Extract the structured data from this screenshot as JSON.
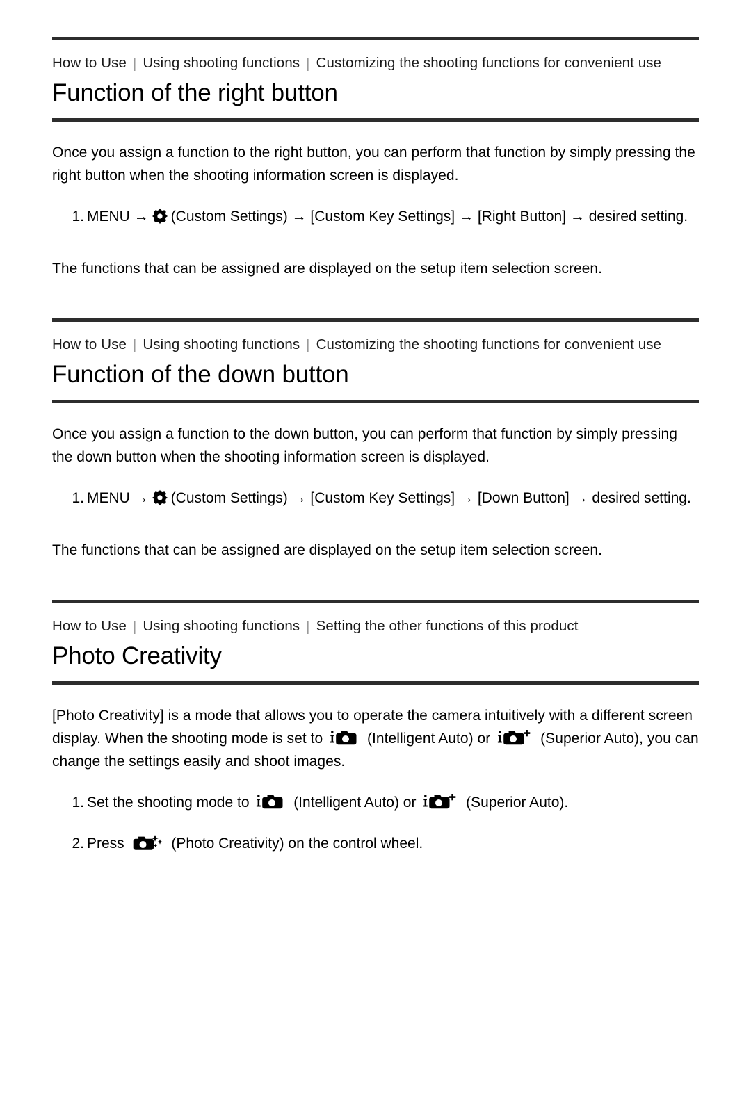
{
  "document": {
    "title": "Function of the right button / Function of the down button / Photo Creativity",
    "sections": [
      {
        "id": "function-right-button",
        "breadcrumb": [
          "How to Use",
          "Using shooting functions",
          "Customizing the shooting functions for convenient use"
        ],
        "heading": "Function of the right button",
        "intro": "Once you assign a function to the right button, you can perform that function by simply pressing the right button when the shooting information screen is displayed.",
        "step_number": "1.",
        "step_part1": "MENU →",
        "step_icon": "gear-icon",
        "step_part2": "(Custom Settings) → [Custom Key Settings] → [Right Button] → desired setting.",
        "note": "The functions that can be assigned are displayed on the setup item selection screen."
      },
      {
        "id": "function-down-button",
        "breadcrumb": [
          "How to Use",
          "Using shooting functions",
          "Customizing the shooting functions for convenient use"
        ],
        "heading": "Function of the down button",
        "intro": "Once you assign a function to the down button, you can perform that function by simply pressing the down button when the shooting information screen is displayed.",
        "step_number": "1.",
        "step_part1": "MENU →",
        "step_icon": "gear-icon",
        "step_part2": "(Custom Settings) → [Custom Key Settings] → [Down Button] → desired setting.",
        "note": "The functions that can be assigned are displayed on the setup item selection screen."
      },
      {
        "id": "photo-creativity",
        "breadcrumb": [
          "How to Use",
          "Using shooting functions",
          "Setting the other functions of this product"
        ],
        "heading": "Photo Creativity",
        "intro_part1": "[Photo Creativity] is a mode that allows you to operate the camera intuitively with a different screen display. When the shooting mode is set to",
        "intro_icon1": "intelligent-auto-icon",
        "intro_part2": "(Intelligent Auto) or",
        "intro_icon2": "superior-auto-icon",
        "intro_part3": "(Superior Auto), you can change the settings easily and shoot images.",
        "steps": [
          {
            "number": "1.",
            "part1": "Set the shooting mode to",
            "icon1": "intelligent-auto-icon",
            "part2": "(Intelligent Auto) or",
            "icon2": "superior-auto-icon",
            "part3": "(Superior Auto)."
          },
          {
            "number": "2.",
            "part1": "Press",
            "icon1": "photo-creativity-icon",
            "part2": "(Photo Creativity) on the control wheel."
          }
        ]
      }
    ]
  },
  "colors": {
    "rule": "#2d2d2d",
    "text": "#000000",
    "separator": "#9a9a9a",
    "background": "#ffffff"
  },
  "icons": {
    "gear-icon": "gear",
    "intelligent-auto-icon": "i-camera",
    "superior-auto-icon": "i-camera-plus",
    "photo-creativity-icon": "camera-sparkle"
  }
}
